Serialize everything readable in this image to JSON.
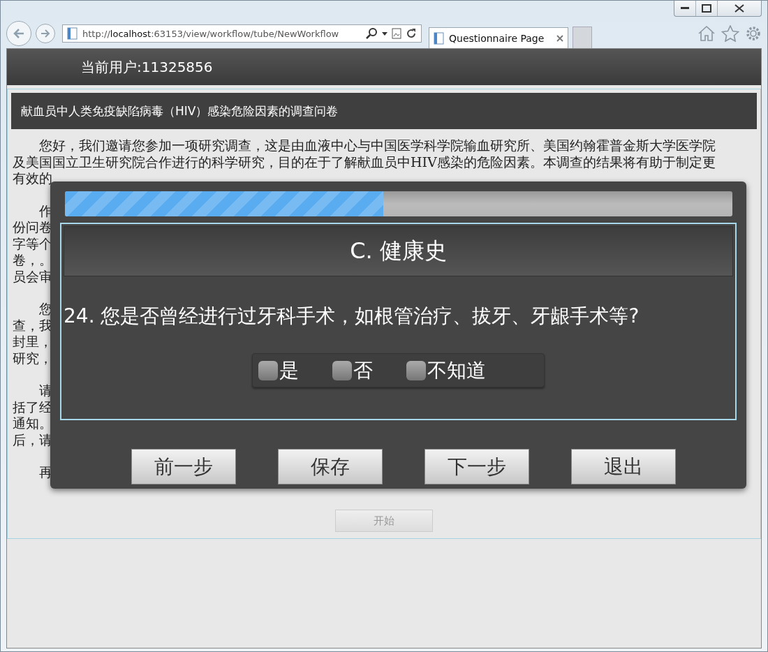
{
  "browser": {
    "address": "http://**localhost**:63153/view/workflow/tube/NewWorkflow",
    "tab": {
      "title": "Questionnaire Page",
      "selected": true
    }
  },
  "header": {
    "user_label": "当前用户:11325856"
  },
  "page": {
    "title": "献血员中人类免疫缺陷病毒（HIV）感染危险因素的调查问卷",
    "paragraphs": [
      {
        "lines": [
          "您好，我们邀请您参加一项研究调查，这是由血液中心与中国医学科学院输血研究所、美国约翰霍普金斯大学医学院",
          "及美国国立卫生研究院合作进行的科学研究，目的在于了解献血员中HIV感染的危险因素。本调查的结果将有助于制定更",
          "有效的"
        ]
      },
      {
        "lines": [
          "作",
          "份问卷",
          "字等个",
          "卷，。",
          "员会审"
        ]
      },
      {
        "lines": [
          "您",
          "查，我",
          "封里，",
          "研究，"
        ]
      },
      {
        "lines": [
          "请",
          "括了经",
          "通知。",
          "后，请"
        ]
      },
      {
        "lines": [
          "再"
        ]
      }
    ],
    "start_button": {
      "label": "开始",
      "disabled": true
    }
  },
  "dialog": {
    "progress": {
      "level": 0.477
    },
    "section_title": "C. 健康史",
    "question": {
      "number": "24.",
      "text": "您是否曾经进行过牙科手术，如根管治疗、拔牙、牙龈手术等?"
    },
    "options": [
      {
        "label": "是",
        "checked": false
      },
      {
        "label": "否",
        "checked": false
      },
      {
        "label": "不知道",
        "checked": false
      }
    ],
    "buttons": [
      "前一步",
      "保存",
      "下一步",
      "退出"
    ]
  }
}
